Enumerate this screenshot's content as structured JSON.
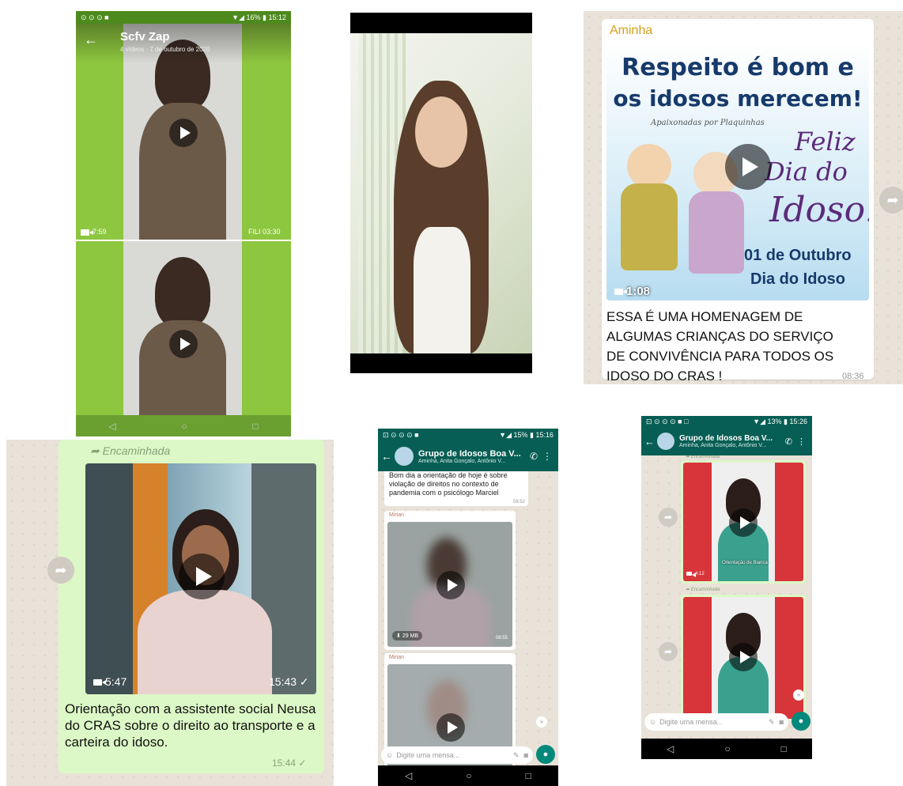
{
  "panel1": {
    "status_icons": "⊙ ⊙ ⊙ ■",
    "status_right": "▼◢ 16% ▮ 15:12",
    "title": "Scfv Zap",
    "subtitle": "4 vídeos · 7 de outubro de 2020",
    "video1_duration": "7:59",
    "video1_tag": "FILI 03:30"
  },
  "panel3": {
    "sender": "Aminha",
    "poster_line1": "Respeito é bom e",
    "poster_line2": "os idosos merecem!",
    "poster_script": "Apaixonadas por Plaquinhas",
    "poster_feliz": "Feliz",
    "poster_dia": "Dia do",
    "poster_idoso": "Idoso!",
    "poster_date": "01 de Outubro",
    "poster_footer": "Dia do Idoso",
    "video_duration": "1:08",
    "caption": "ESSA É UMA HOMENAGEM DE ALGUMAS CRIANÇAS DO SERVIÇO DE CONVIVÊNCIA PARA TODOS OS IDOSO DO CRAS !",
    "time": "08:36"
  },
  "panel4": {
    "forwarded_label": "Encaminhada",
    "video_duration": "5:47",
    "video_time": "15:43 ✓",
    "caption": "Orientação com a assistente social Neusa do CRAS  sobre o direito ao transporte e a carteira do idoso.",
    "time": "15:44 ✓"
  },
  "panel5": {
    "status_right": "▼◢ 15% ▮ 15:16",
    "group_name": "Grupo de Idosos Boa V...",
    "participants": "Aminha, Anita Gonçalo, Antônio V...",
    "message_text": "Bom dia a orientação de hoje é sobre violação de direitos no contexto de pandemia com o psicólogo Marciel",
    "message_time": "08:52",
    "sender1": "Mirian",
    "video1_size": "29 MB",
    "video1_time": "08:55",
    "sender2": "Mirian",
    "input_placeholder": "Digite uma mensa..."
  },
  "panel6": {
    "status_right": "▼◢ 13% ▮ 15:26",
    "group_name": "Grupo de Idosos Boa V...",
    "participants": "Aminha, Anita Gonçalo, Antônio V...",
    "forwarded_label": "Encaminhada",
    "video1_duration": "4:12",
    "video1_caption": "Orientação de Bianca",
    "input_placeholder": "Digite uma mensa..."
  },
  "colors": {
    "whatsapp_header": "#075e54",
    "bubble_green": "#dcf8c6",
    "green_bg": "#8dc63f",
    "red_bg": "#d8353a",
    "mic_button": "#00897b"
  }
}
